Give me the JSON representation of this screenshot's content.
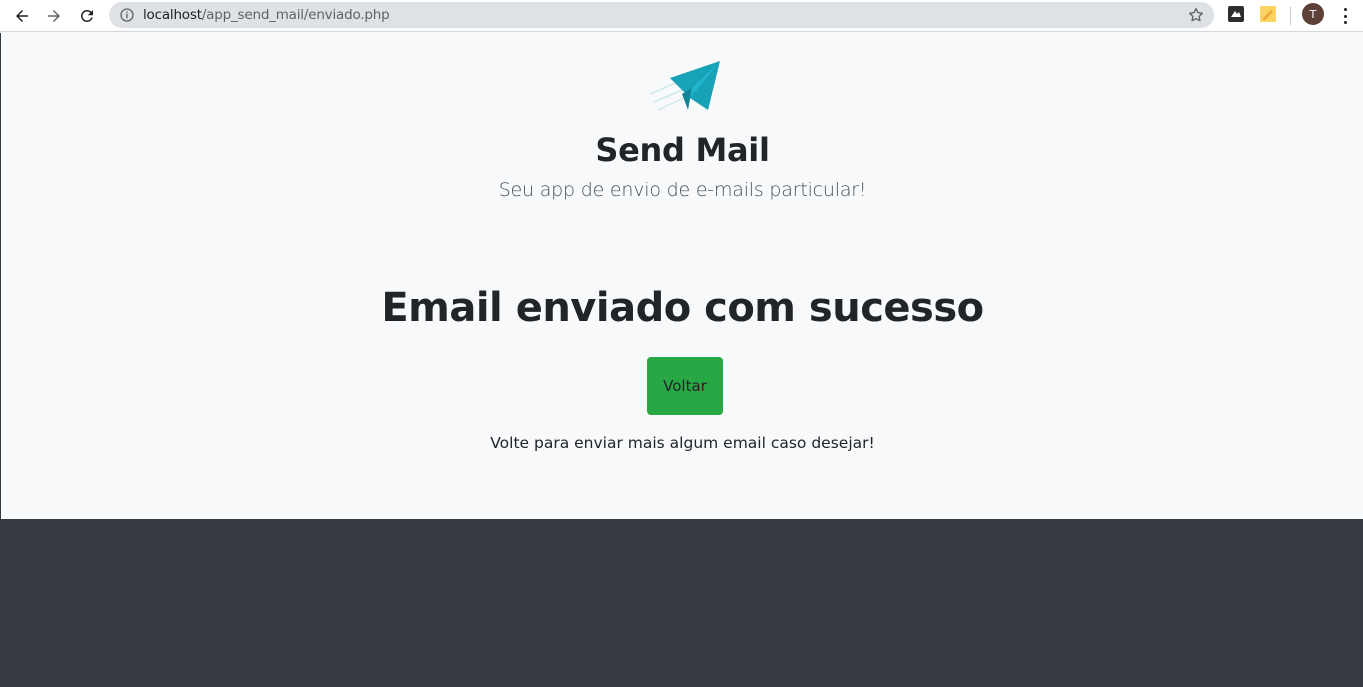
{
  "browser": {
    "url_host": "localhost",
    "url_path": "/app_send_mail/enviado.php",
    "avatar_initial": "T",
    "icons": [
      "back-arrow-icon",
      "forward-arrow-icon",
      "reload-icon",
      "info-icon",
      "star-icon",
      "extension-icon",
      "notes-extension-icon",
      "menu-dots-icon"
    ]
  },
  "header": {
    "logo": "paper-plane-icon",
    "title": "Send Mail",
    "lead": "Seu app de envio de e-mails particular!"
  },
  "main": {
    "heading": "Email enviado com sucesso",
    "button_label": "Voltar",
    "hint": "Volte para enviar mais algum email caso desejar!"
  },
  "colors": {
    "accent": "#17a2b8",
    "button": "#28a745",
    "footer": "#343a40",
    "background": "#f8f9fa"
  }
}
